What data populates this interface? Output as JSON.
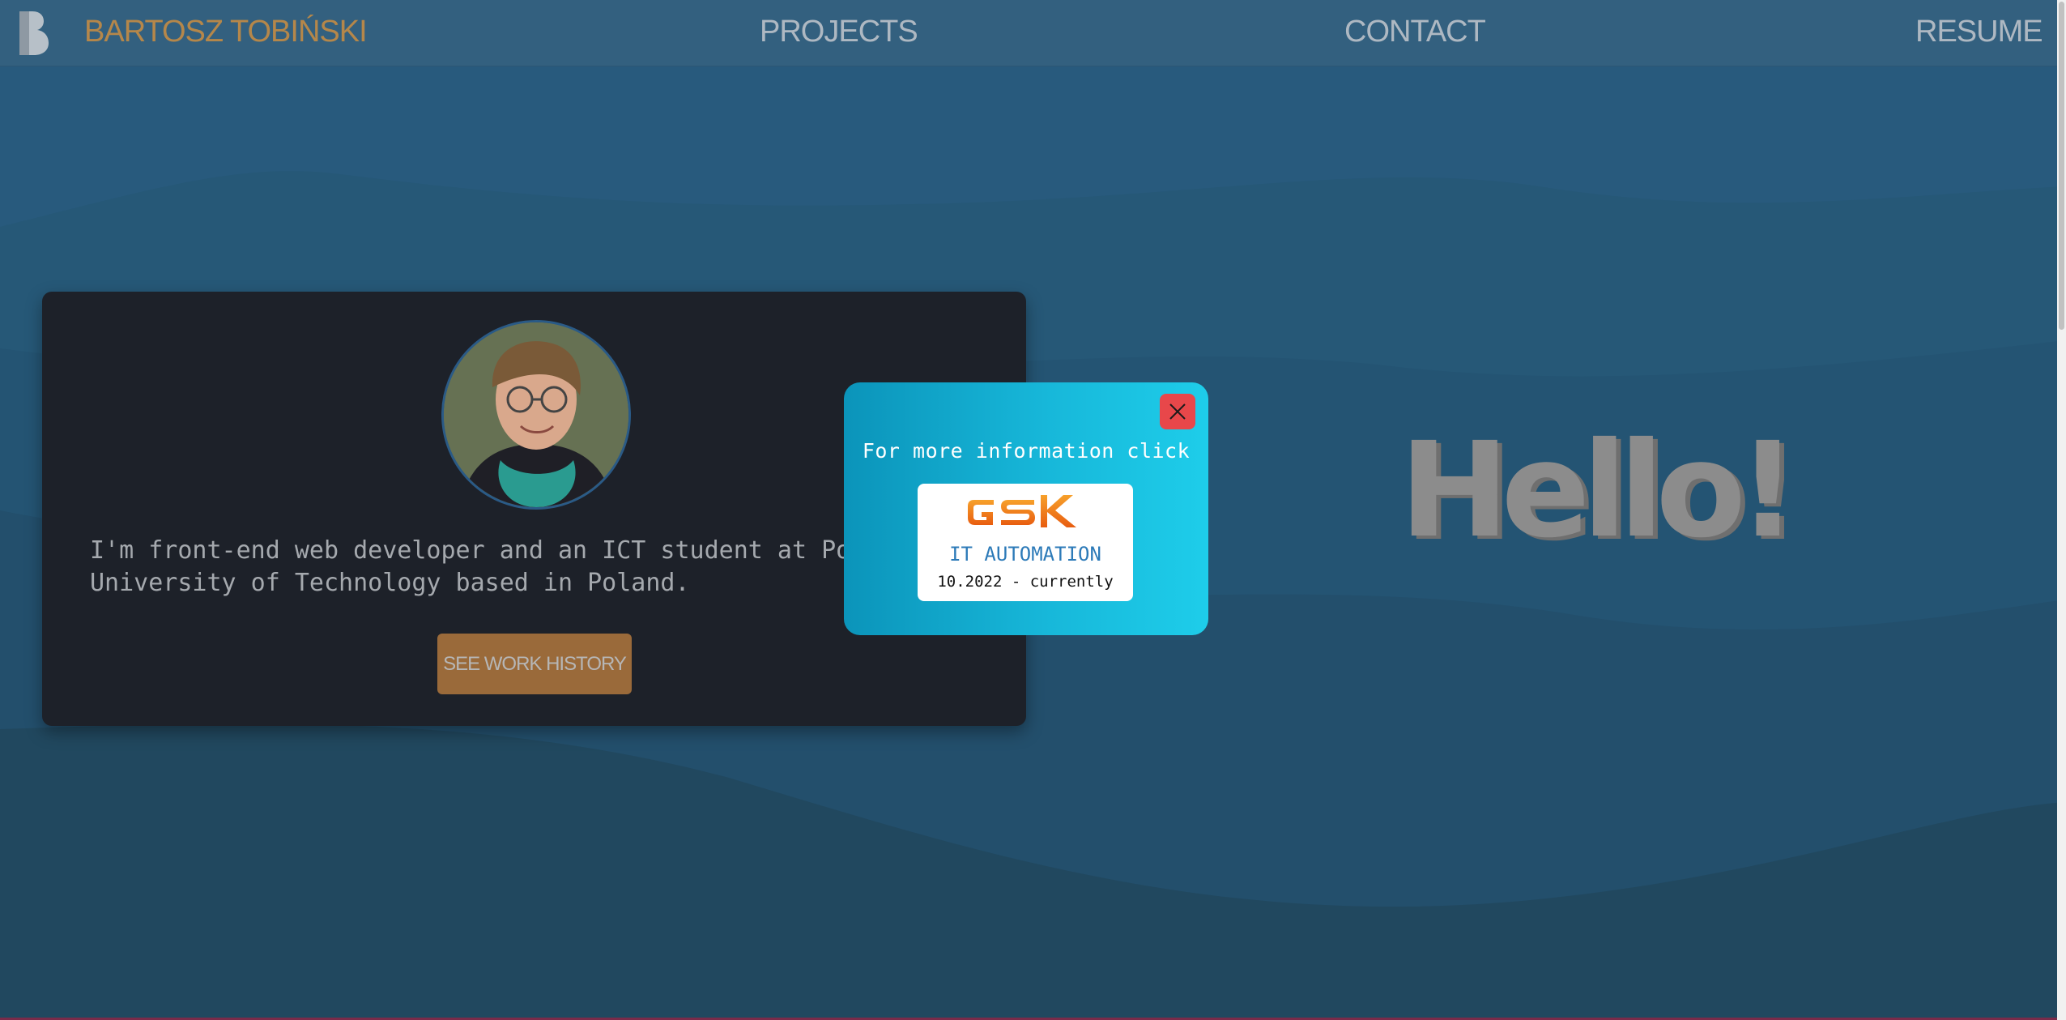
{
  "nav": {
    "brand": "BARTOSZ TOBIŃSKI",
    "links": [
      "PROJECTS",
      "CONTACT",
      "RESUME"
    ],
    "logo_icon": "letter-b-logo",
    "brand_color": "#b5874a",
    "link_color": "#aeb8c2"
  },
  "profile": {
    "avatar_icon": "profile-photo",
    "bio": "I'm front-end web developer and an ICT student at Po\nUniversity of Technology based in Poland.",
    "button_label": "SEE WORK HISTORY",
    "button_color": "#9a6a3a"
  },
  "popup": {
    "text": "For more information click",
    "close_icon": "close-icon",
    "job": {
      "company": "GSK",
      "title": "IT AUTOMATION",
      "period": "10.2022 - currently"
    },
    "accent_color": "#e8474a"
  },
  "hero": {
    "greeting": "Hello!"
  }
}
